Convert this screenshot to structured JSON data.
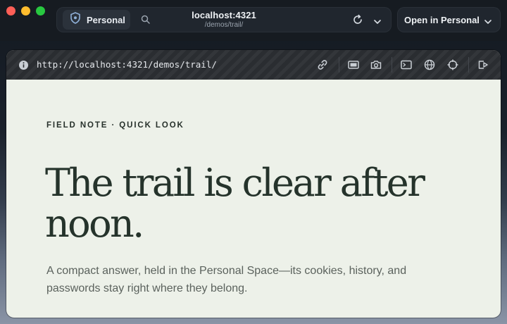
{
  "chrome": {
    "space_label": "Personal",
    "url_host": "localhost:4321",
    "url_path": "/demos/trail/",
    "open_button_label": "Open in Personal"
  },
  "devbar": {
    "url": "http://localhost:4321/demos/trail/"
  },
  "page": {
    "eyebrow": "FIELD NOTE · QUICK LOOK",
    "headline": "The trail is clear after noon.",
    "lede": "A compact answer, held in the Personal Space—its cookies, history, and passwords stay right where they belong."
  },
  "icons": [
    "shield-icon",
    "search-icon",
    "reload-icon",
    "chevron-down-icon",
    "info-icon",
    "link-icon",
    "screen-icon",
    "camera-icon",
    "terminal-icon",
    "globe-icon",
    "crosshair-icon",
    "exit-icon"
  ],
  "colors": {
    "page_background": "#edf1e9",
    "headline": "#25332b",
    "chrome": "#161b21"
  }
}
